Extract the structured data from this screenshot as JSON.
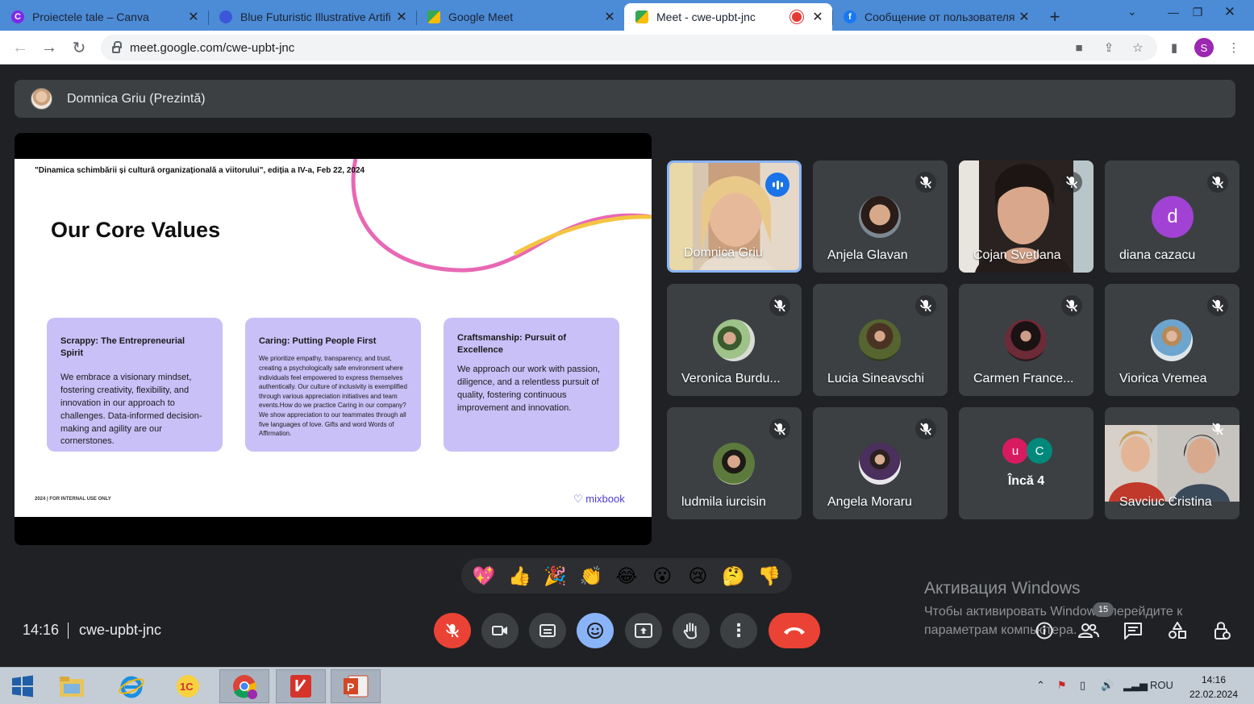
{
  "browser": {
    "tabs": [
      {
        "title": "Proiectele tale – Canva",
        "favicon": "canva-icon",
        "color": "#7d2ae8",
        "letter": "C"
      },
      {
        "title": "Blue Futuristic Illustrative Artifi",
        "favicon": "canva-design-icon",
        "color": "#3b56d8",
        "letter": ""
      },
      {
        "title": "Google Meet",
        "favicon": "google-meet-icon",
        "color": "#00897b",
        "letter": ""
      },
      {
        "title": "Meet - cwe-upbt-jnc",
        "favicon": "google-meet-icon",
        "color": "#00897b",
        "letter": ""
      },
      {
        "title": "Сообщение от пользователя",
        "favicon": "facebook-icon",
        "color": "#1877f2",
        "letter": "f"
      }
    ],
    "active_tab": 3,
    "url": "meet.google.com/cwe-upbt-jnc",
    "profile_letter": "S"
  },
  "meet": {
    "presenter": "Domnica Griu (Prezintă)",
    "slide": {
      "conference": "\"Dinamica schimbării și cultură organizațională a viitorului\", ediția a IV-a, Feb 22, 2024",
      "title": "Our Core Values",
      "cards": [
        {
          "title": "Scrappy: The Entrepreneurial Spirit",
          "body": "We embrace a visionary mindset, fostering creativity, flexibility, and innovation in our approach to challenges. Data-informed decision-making and agility are our cornerstones."
        },
        {
          "title": "Caring: Putting People First",
          "body": "We prioritize empathy, transparency, and trust, creating a psychologically safe environment where individuals feel empowered to express themselves authentically. Our culture of inclusivity is exemplified through various appreciation initiatives and team events.How do we practice Caring in our company? We show appreciation to our teammates through all five languages of love. Gifts and word Words of Affirmation."
        },
        {
          "title": "Craftsmanship: Pursuit of Excellence",
          "body": "We approach our work with passion, diligence, and a relentless pursuit of quality, fostering continuous improvement and innovation."
        }
      ],
      "footer": "2024 | FOR INTERNAL USE ONLY",
      "brand": "mixbook"
    },
    "participants": [
      {
        "name": "Domnica Griu"
      },
      {
        "name": "Anjela Glavan"
      },
      {
        "name": "Cojan Svetlana"
      },
      {
        "name": "diana cazacu",
        "letter": "d"
      },
      {
        "name": "Veronica Burdu..."
      },
      {
        "name": "Lucia Sineavschi"
      },
      {
        "name": "Carmen France..."
      },
      {
        "name": "Viorica Vremea"
      },
      {
        "name": "ludmila iurcisin"
      },
      {
        "name": "Angela Moraru"
      },
      {
        "name": "Încă 4",
        "letters": [
          "u",
          "C"
        ]
      },
      {
        "name": "Savciuc Cristina"
      }
    ],
    "reactions": [
      "💖",
      "👍",
      "🎉",
      "👏",
      "😂",
      "😮",
      "😢",
      "🤔",
      "👎"
    ],
    "time": "14:16",
    "meeting_code": "cwe-upbt-jnc",
    "people_count": "15"
  },
  "watermark": {
    "title": "Активация Windows",
    "line1": "Чтобы активировать Windows, перейдите к",
    "line2": "параметрам компьютера."
  },
  "taskbar": {
    "language": "ROU",
    "time": "14:16",
    "date": "22.02.2024"
  },
  "colors": {
    "tab_strip": "#4c8bd6",
    "meet_bg": "#202124",
    "tile_bg": "#3c4043",
    "card_purple": "#c8c0f7",
    "end_call": "#ea4335",
    "speaking_ring": "#8ab4f8"
  }
}
